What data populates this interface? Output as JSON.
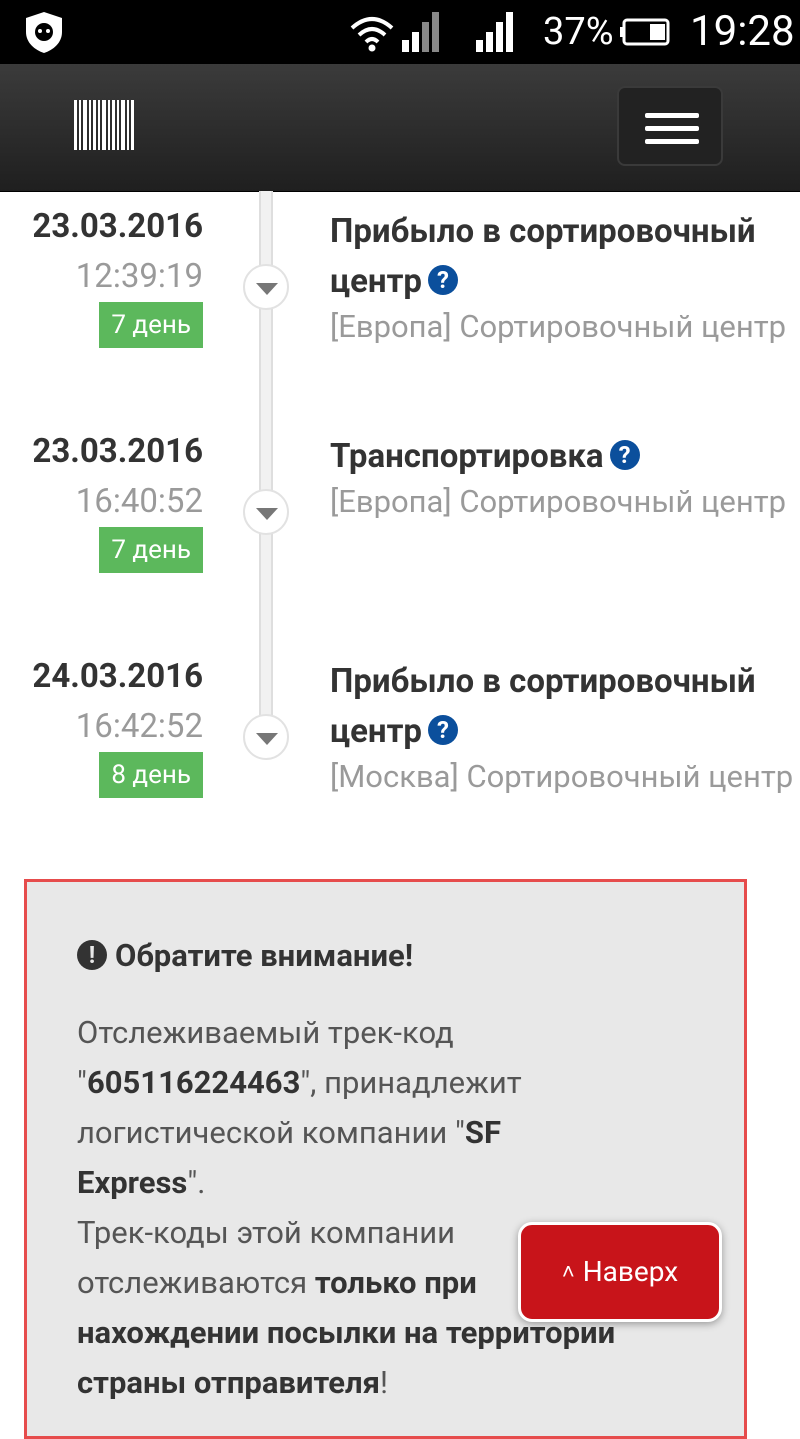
{
  "status_bar": {
    "battery": "37%",
    "time": "19:28"
  },
  "navbar": {
    "logo_icon": "barcode-icon",
    "menu_icon": "hamburger-icon"
  },
  "events": [
    {
      "date": "23.03.2016",
      "time": "12:39:19",
      "day_badge": "7 день",
      "title_line1": "Прибыло в сортировочный",
      "title_line2": "центр",
      "location": "[Европа] Сортировочный центр"
    },
    {
      "date": "23.03.2016",
      "time": "16:40:52",
      "day_badge": "7 день",
      "title_line1": "Транспортировка",
      "title_line2": "",
      "location": "[Европа] Сортировочный центр"
    },
    {
      "date": "24.03.2016",
      "time": "16:42:52",
      "day_badge": "8 день",
      "title_line1": "Прибыло в сортировочный",
      "title_line2": "центр",
      "location": "[Москва] Сортировочный центр"
    }
  ],
  "notice": {
    "heading": "Обратите внимание!",
    "text_1": "Отслеживаемый трек-код",
    "quote_open": "\"",
    "track_code": "605116224463",
    "text_2": "\", принадлежит",
    "text_3": "логистической компании \"",
    "company_line1": "SF",
    "company_line2": "Express",
    "text_4": "\".",
    "text_5": "Трек-коды этой компании",
    "text_6": "отслеживаются ",
    "emph_1": "только при",
    "emph_2": "нахождении посылки на территории",
    "emph_3": "страны отправителя",
    "text_7": "!"
  },
  "to_top": {
    "label": "Наверх",
    "color": "#c8141a"
  },
  "colors": {
    "badge": "#5cb85c",
    "help_icon": "#0b4f9c",
    "notice_border": "#e64c4c"
  }
}
